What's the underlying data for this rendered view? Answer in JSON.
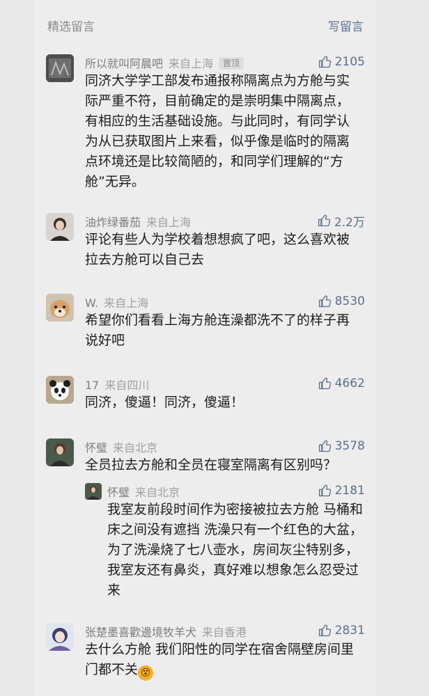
{
  "header": {
    "title": "精选留言",
    "write": "写留言"
  },
  "comments": [
    {
      "name": "所以就叫阿晨吧",
      "location": "来自上海",
      "pinned": "置顶",
      "likes": "2105",
      "text": "同济大学学工部发布通报称隔离点为方舱与实际严重不符，目前确定的是崇明集中隔离点，有相应的生活基础设施。与此同时，有同学认为从已获取图片上来看，似乎像是临时的隔离点环境还是比较简陋的，和同学们理解的“方舱”无异。"
    },
    {
      "name": "油炸绿番茄",
      "location": "来自上海",
      "likes": "2.2万",
      "text": "评论有些人为学校着想想疯了吧，这么喜欢被拉去方舱可以自己去"
    },
    {
      "name": "W.",
      "location": "来自上海",
      "likes": "8530",
      "text": "希望你们看看上海方舱连澡都洗不了的样子再说好吧"
    },
    {
      "name": "17",
      "location": "来自四川",
      "likes": "4662",
      "text": "同济，傻逼！同济，傻逼！"
    },
    {
      "name": "怀璧",
      "location": "来自北京",
      "likes": "3578",
      "text": "全员拉去方舱和全员在寝室隔离有区别吗？",
      "reply": {
        "name": "怀璧",
        "location": "来自北京",
        "likes": "2181",
        "text": "我室友前段时间作为密接被拉去方舱 马桶和床之间没有遮挡 洗澡只有一个红色的大盆，为了洗澡烧了七八壶水，房间灰尘特别多，我室友还有鼻炎，真好难以想象怎么忍受过来"
      }
    },
    {
      "name": "张楚墨喜歡邊境牧羊犬",
      "location": "来自香港",
      "likes": "2831",
      "text": "去什么方舱 我们阳性的同学在宿舍隔壁房间里门都不关",
      "emoji": "😵"
    }
  ]
}
